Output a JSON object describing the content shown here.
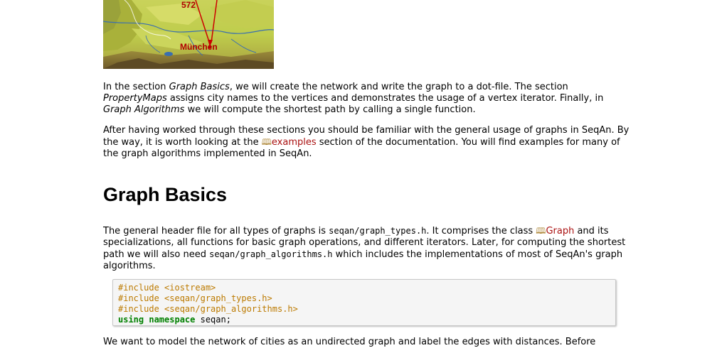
{
  "map": {
    "distance_label": "572",
    "city_label": "München"
  },
  "intro": {
    "p1_a": "In the section ",
    "p1_em1": "Graph Basics",
    "p1_b": ", we will create the network and write the graph to a dot-file. The section ",
    "p1_em2": "PropertyMaps",
    "p1_c": " assigns city names to the vertices and demonstrates the usage of a vertex iterator. Finally, in ",
    "p1_em3": "Graph Algorithms",
    "p1_d": " we will compute the shortest path by calling a single function.",
    "p2_a": "After having worked through these sections you should be familiar with the general usage of graphs in SeqAn. By the way, it is worth looking at the ",
    "p2_link": "examples",
    "p2_b": " section of the documentation. You will find examples for many of the graph algorithms implemented in SeqAn."
  },
  "section": {
    "title": "Graph Basics",
    "p_a": "The general header file for all types of graphs is ",
    "p_code1": "seqan/graph_types.h",
    "p_b": ". It comprises the class ",
    "p_link": "Graph",
    "p_c": " and its specializations, all functions for basic graph operations, and different iterators. Later, for computing the shortest path we will also need ",
    "p_code2": "seqan/graph_algorithms.h",
    "p_d": " which includes the implementations of most of SeqAn's graph algorithms."
  },
  "code": {
    "line1": "#include <iostream>",
    "line2": "#include <seqan/graph_types.h>",
    "line3": "#include <seqan/graph_algorithms.h>",
    "line4_kw": "using namespace",
    "line4_rest": " seqan;"
  },
  "bottom": {
    "text": "We want to model the network of cities as an undirected graph and label the edges with distances. Before"
  },
  "colors": {
    "link": "#aa1111",
    "preprocessor": "#bc7a00",
    "keyword": "#008000"
  },
  "icons": {
    "book": "book-icon"
  }
}
